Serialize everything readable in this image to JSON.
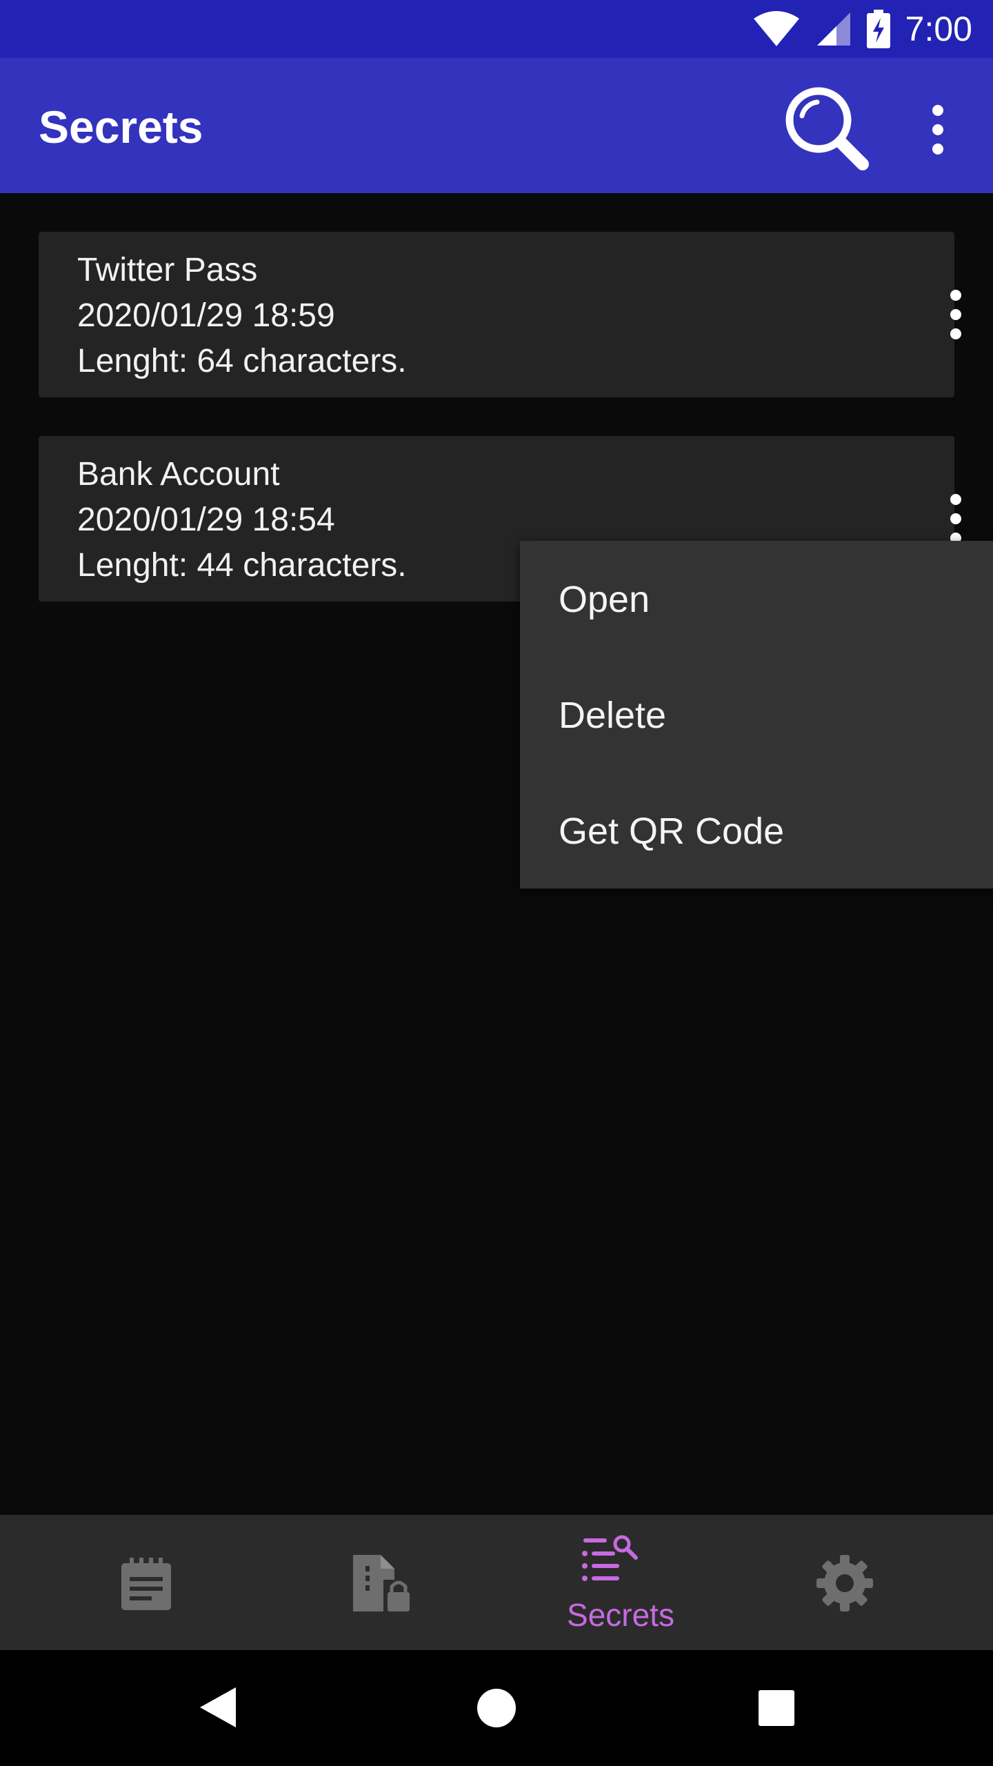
{
  "status_bar": {
    "time": "7:00",
    "icons": [
      "wifi-icon",
      "cellular-signal-icon",
      "battery-charging-icon"
    ]
  },
  "app_bar": {
    "title": "Secrets",
    "actions": [
      "search-icon",
      "more-vert-icon"
    ]
  },
  "secrets": [
    {
      "name": "Twitter Pass",
      "date": "2020/01/29 18:59",
      "length": "Lenght: 64 characters."
    },
    {
      "name": "Bank Account",
      "date": "2020/01/29 18:54",
      "length": "Lenght: 44 characters."
    }
  ],
  "popup_menu": {
    "items": [
      "Open",
      "Delete",
      "Get QR Code"
    ]
  },
  "bottom_nav": {
    "items": [
      {
        "icon": "notes-icon",
        "label": ""
      },
      {
        "icon": "locked-file-icon",
        "label": ""
      },
      {
        "icon": "secrets-list-search-icon",
        "label": "Secrets",
        "active": true
      },
      {
        "icon": "gear-icon",
        "label": ""
      }
    ],
    "active_label": "Secrets"
  },
  "colors": {
    "status_bar": "#2222b4",
    "app_bar": "#3333bd",
    "background": "#0a0a0a",
    "card": "#242424",
    "menu": "#333333",
    "accent": "#c66be0",
    "inactive_icon": "#6e6e6e"
  },
  "system_nav": [
    "back-icon",
    "home-icon",
    "recents-icon"
  ]
}
